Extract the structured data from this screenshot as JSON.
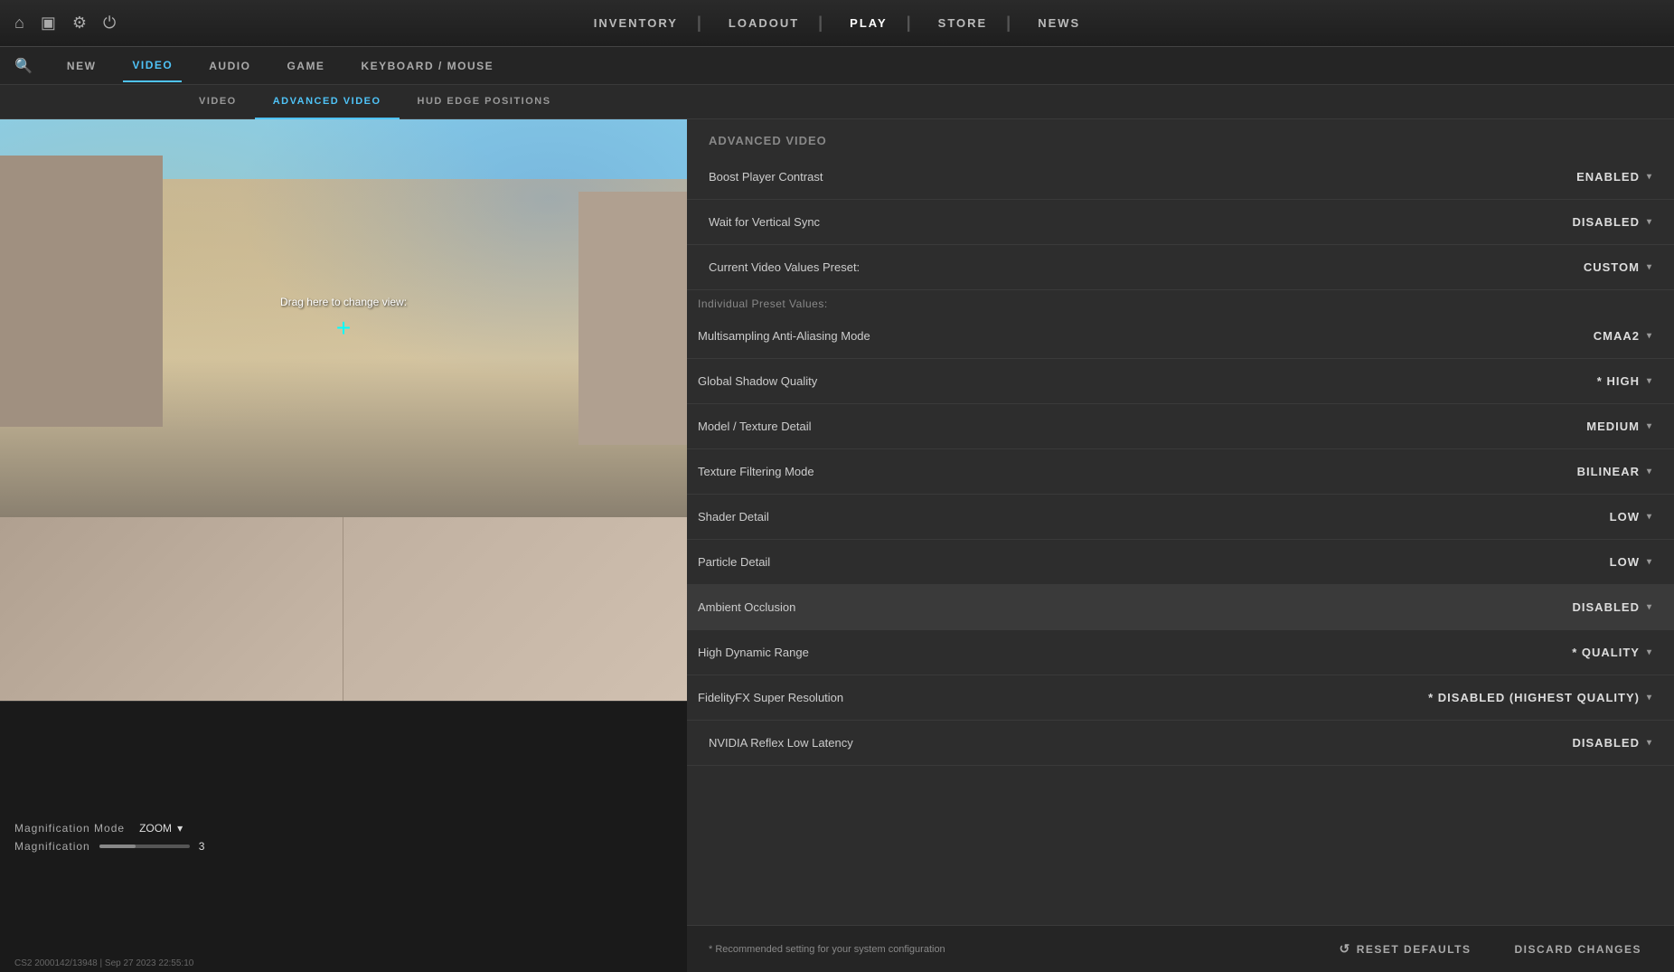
{
  "topNav": {
    "icons": [
      "home",
      "tv",
      "settings",
      "power"
    ],
    "links": [
      {
        "label": "INVENTORY",
        "active": false
      },
      {
        "label": "LOADOUT",
        "active": false
      },
      {
        "label": "PLAY",
        "active": true
      },
      {
        "label": "STORE",
        "active": false
      },
      {
        "label": "NEWS",
        "active": false
      }
    ]
  },
  "settingsNav": {
    "searchPlaceholder": "Search",
    "links": [
      {
        "label": "NEW",
        "active": false
      },
      {
        "label": "VIDEO",
        "active": true
      },
      {
        "label": "AUDIO",
        "active": false
      },
      {
        "label": "GAME",
        "active": false
      },
      {
        "label": "KEYBOARD / MOUSE",
        "active": false
      }
    ]
  },
  "subTabs": [
    {
      "label": "VIDEO",
      "active": false
    },
    {
      "label": "ADVANCED VIDEO",
      "active": true
    },
    {
      "label": "HUD EDGE POSITIONS",
      "active": false
    }
  ],
  "gameView": {
    "dragText": "Drag here to change view:",
    "crosshair": "+"
  },
  "bottomStatus": {
    "magnificationLabel": "Magnification Mode",
    "zoomValue": "ZOOM",
    "magnificationLabel2": "Magnification",
    "magnificationValue": "3",
    "buildInfo": "CS2 2000142/13948 | Sep 27 2023 22:55:10"
  },
  "advancedVideo": {
    "sectionTitle": "Advanced Video",
    "rows": [
      {
        "label": "Boost Player Contrast",
        "value": "ENABLED",
        "highlighted": false
      },
      {
        "label": "Wait for Vertical Sync",
        "value": "DISABLED",
        "highlighted": false
      },
      {
        "label": "Current Video Values Preset:",
        "value": "CUSTOM",
        "highlighted": false
      }
    ],
    "individualPresetLabel": "Individual Preset Values:",
    "presetRows": [
      {
        "label": "Multisampling Anti-Aliasing Mode",
        "value": "CMAA2",
        "highlighted": false
      },
      {
        "label": "Global Shadow Quality",
        "value": "* HIGH",
        "highlighted": false
      },
      {
        "label": "Model / Texture Detail",
        "value": "MEDIUM",
        "highlighted": false
      },
      {
        "label": "Texture Filtering Mode",
        "value": "BILINEAR",
        "highlighted": false
      },
      {
        "label": "Shader Detail",
        "value": "LOW",
        "highlighted": false
      },
      {
        "label": "Particle Detail",
        "value": "LOW",
        "highlighted": false
      },
      {
        "label": "Ambient Occlusion",
        "value": "DISABLED",
        "highlighted": true
      },
      {
        "label": "High Dynamic Range",
        "value": "* QUALITY",
        "highlighted": false
      },
      {
        "label": "FidelityFX Super Resolution",
        "value": "* DISABLED (HIGHEST QUALITY)",
        "highlighted": false
      }
    ],
    "nvidiaRow": {
      "label": "NVIDIA Reflex Low Latency",
      "value": "DISABLED"
    },
    "recommendedText": "* Recommended setting for your system configuration",
    "resetBtn": "RESET DEFAULTS",
    "discardBtn": "DISCARD CHANGES"
  }
}
